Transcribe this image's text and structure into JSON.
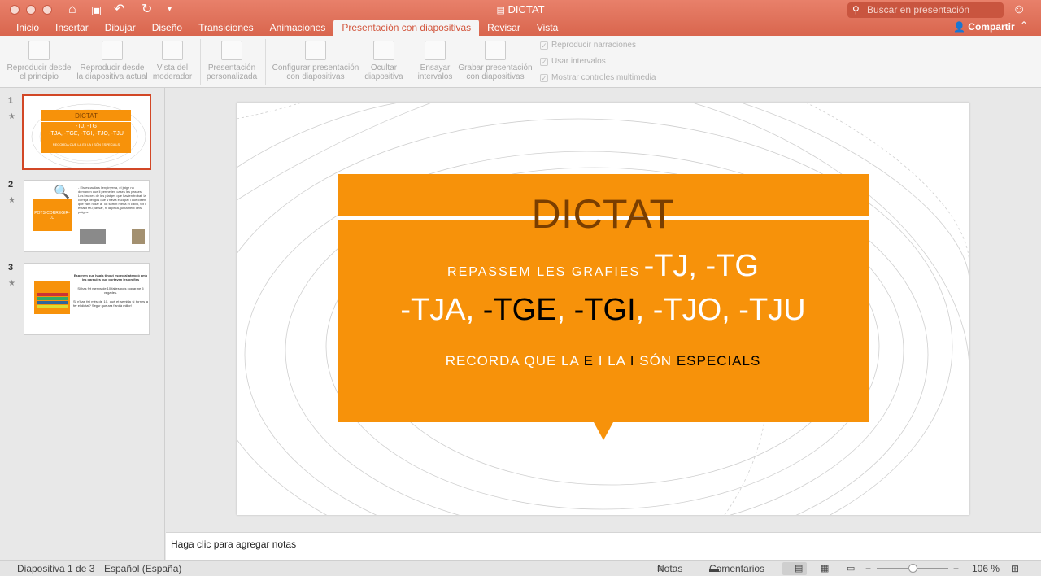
{
  "window": {
    "title": "DICTAT"
  },
  "search": {
    "placeholder": "Buscar en presentación"
  },
  "tabs": [
    {
      "label": "Inicio"
    },
    {
      "label": "Insertar"
    },
    {
      "label": "Dibujar"
    },
    {
      "label": "Diseño"
    },
    {
      "label": "Transiciones"
    },
    {
      "label": "Animaciones"
    },
    {
      "label": "Presentación con diapositivas"
    },
    {
      "label": "Revisar"
    },
    {
      "label": "Vista"
    }
  ],
  "active_tab": "Presentación con diapositivas",
  "share_label": "Compartir",
  "ribbon": {
    "buttons": [
      {
        "line1": "Reproducir desde",
        "line2": "el principio"
      },
      {
        "line1": "Reproducir desde",
        "line2": "la diapositiva actual"
      },
      {
        "line1": "Vista del",
        "line2": "moderador"
      },
      {
        "line1": "Presentación",
        "line2": "personalizada"
      },
      {
        "line1": "Configurar presentación",
        "line2": "con diapositivas"
      },
      {
        "line1": "Ocultar",
        "line2": "diapositiva"
      },
      {
        "line1": "Ensayar",
        "line2": "intervalos"
      },
      {
        "line1": "Grabar presentación",
        "line2": "con diapositivas"
      }
    ],
    "checks": [
      {
        "label": "Reproducir narraciones",
        "checked": true
      },
      {
        "label": "Usar intervalos",
        "checked": true
      },
      {
        "label": "Mostrar controles multimedia",
        "checked": true
      }
    ]
  },
  "thumbnails": {
    "items": [
      {
        "number": "1",
        "selected": true
      },
      {
        "number": "2",
        "selected": false
      },
      {
        "number": "3",
        "selected": false
      }
    ],
    "t1": {
      "title": "DICTAT",
      "l1": "-TJ, -TG",
      "l2": "-TJA, -TGE, -TGI, -TJO, -TJU",
      "l3": "RECORDA QUE LA E I LA I SÓN ESPECIALS"
    },
    "t2": {
      "box": "POTS CORREGIR-LO",
      "text": "- Els espavilats l'enginyeria, el jutge no demanen que li permetien cases les passes. Les bruixes de les platges que havien trobat, la correja del gos que s'havia escapat i que ideen que vam rodar al Tot sortint mena el caixó, tot i estant feu passar, ni la peca, juntament dels pàtges."
    },
    "t3": {
      "heading": "Esperem que hagis tingut especial atenció amb les paraules que portaven les grafies",
      "p1": "Si has fet menys de 10 faltes pots copiar-ne 5 vegades.",
      "p2": "Si n'has fet més de 10, què et sembla si tornes a fer el dictat? Segur que ara t'anirà millor!"
    }
  },
  "slide": {
    "title": "DICTAT",
    "line1_small": "REPASSEM LES GRAFIES",
    "line1_big": "-TJ, -TG",
    "line2": [
      "-TJA,",
      "-TGE",
      ",",
      "-TGI",
      ",",
      "-TJO,",
      "-TJU"
    ],
    "line3": [
      "RECORDA QUE LA",
      "E",
      "I LA",
      "I",
      "SÓN",
      "ESPECIALS"
    ]
  },
  "notes_placeholder": "Haga clic para agregar notas",
  "status": {
    "slide_info": "Diapositiva 1 de 3",
    "language": "Español (España)",
    "notes_label": "Notas",
    "comments_label": "Comentarios",
    "zoom": "106 %"
  }
}
